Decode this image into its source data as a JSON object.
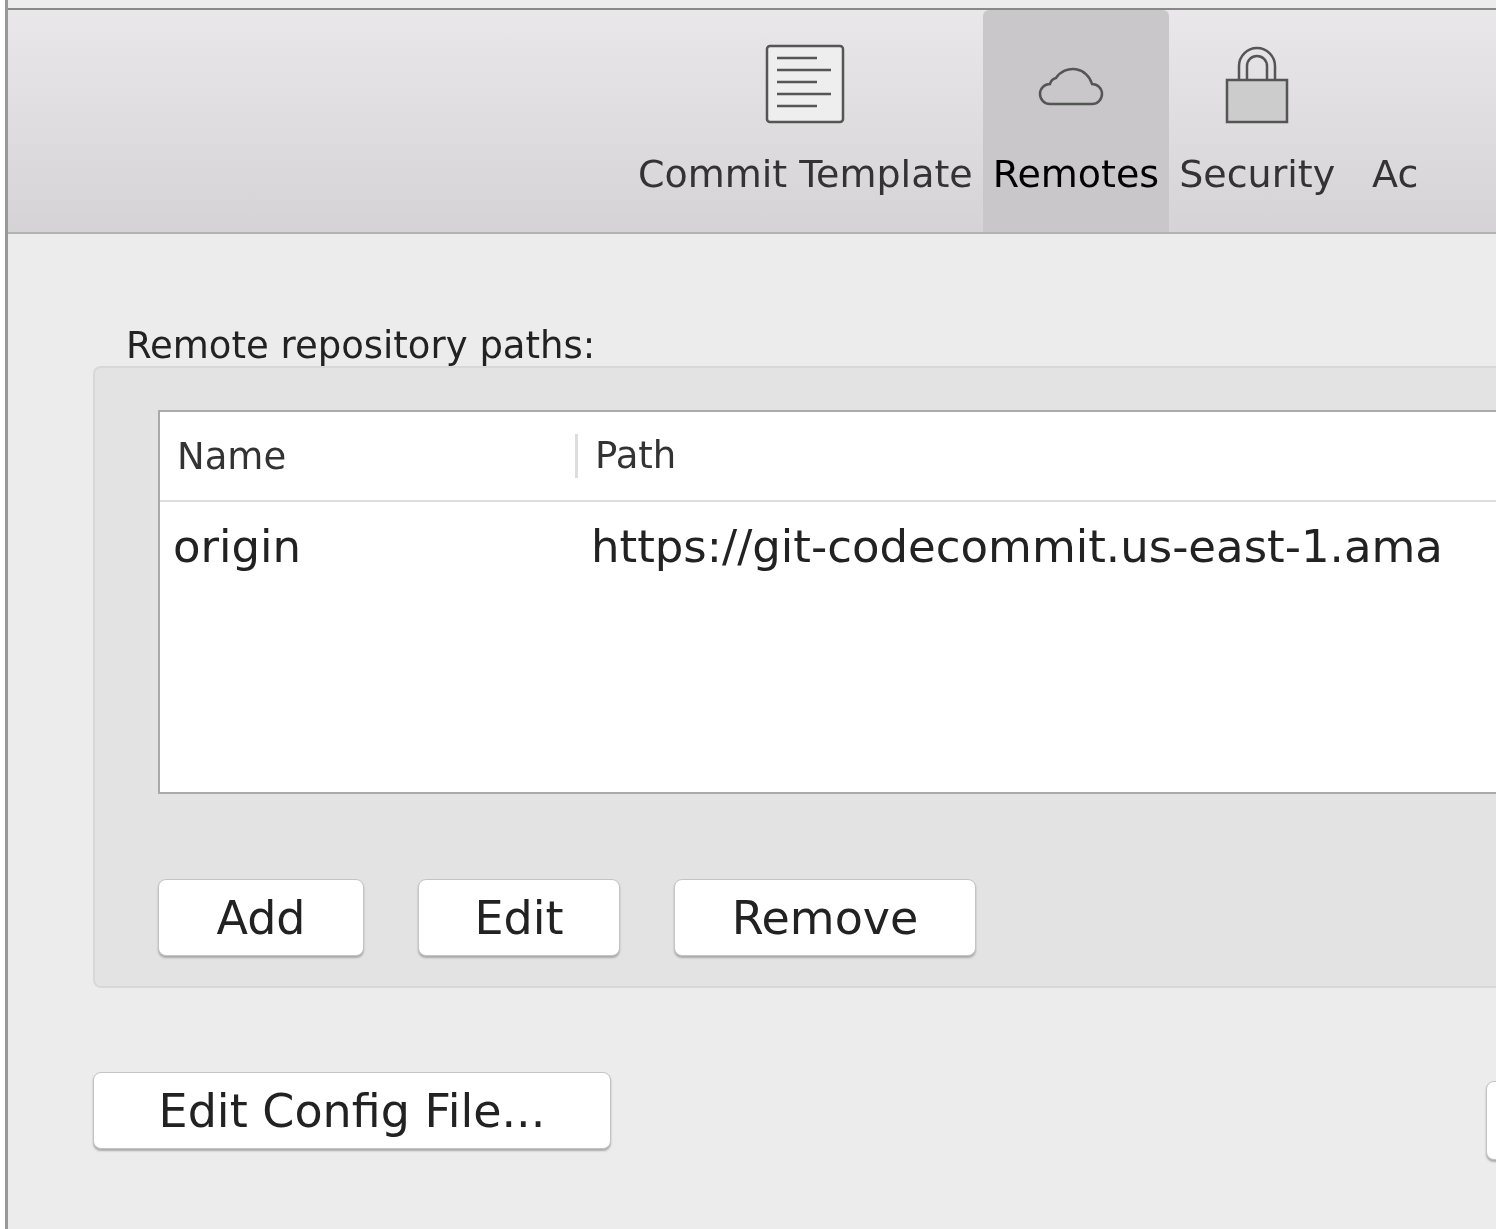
{
  "toolbar": {
    "tabs": [
      {
        "label": "Commit Template",
        "kind": "document",
        "selected": false
      },
      {
        "label": "Remotes",
        "kind": "cloud",
        "selected": true
      },
      {
        "label": "Security",
        "kind": "lock",
        "selected": false
      },
      {
        "label": "Ac",
        "kind": "none",
        "selected": false
      }
    ]
  },
  "remotes": {
    "label": "Remote repository paths:",
    "table": {
      "columns": [
        "Name",
        "Path"
      ],
      "rows": [
        {
          "name": "origin",
          "path": "https://git-codecommit.us-east-1.ama"
        }
      ]
    },
    "buttons": [
      "Add",
      "Edit",
      "Remove"
    ]
  },
  "footer": {
    "buttons": [
      "Edit Config File..."
    ]
  }
}
